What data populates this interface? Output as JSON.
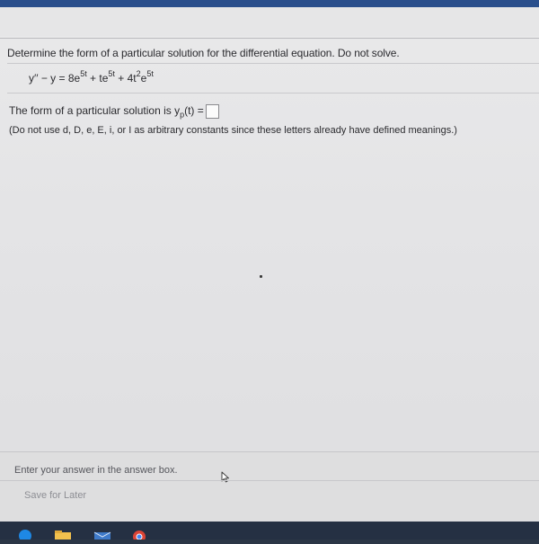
{
  "question": {
    "prompt": "Determine the form of a particular solution for the differential equation. Do not solve."
  },
  "equation": {
    "lhs": "y′′ − y = 8e",
    "exp1": "5t",
    "term2": " + te",
    "exp2": "5t",
    "term3": " + 4t",
    "exp3": "2",
    "term3b": "e",
    "exp4": "5t"
  },
  "answer": {
    "prefix": "The form of a particular solution is y",
    "subscript": "p",
    "suffix": "(t) ="
  },
  "note": "(Do not use d, D, e, E, i, or I as arbitrary constants since these letters already have defined meanings.)",
  "footer": {
    "hint": "Enter your answer in the answer box.",
    "save_label": "Save for Later"
  },
  "taskbar": {
    "icons": [
      "browser-icon",
      "folder-icon",
      "mail-icon",
      "chrome-icon"
    ]
  },
  "colors": {
    "text": "#2b2b2f",
    "hint": "#55565c",
    "save_link": "#8d8e94",
    "taskbar": "#253043"
  }
}
